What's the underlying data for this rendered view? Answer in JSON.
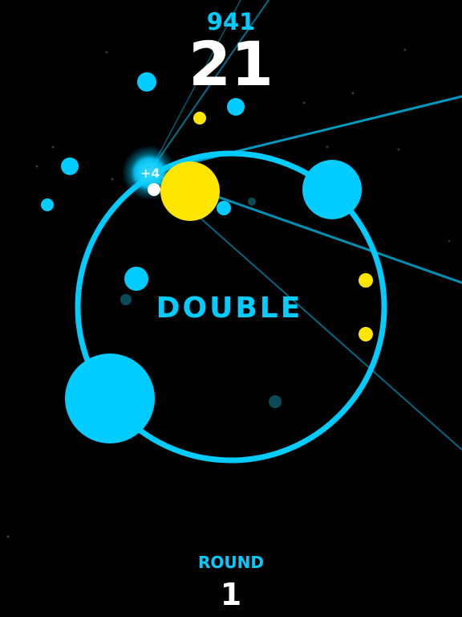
{
  "hud": {
    "best_score": "941",
    "score": "21",
    "round_label": "ROUND",
    "round_number": "1"
  },
  "bonus_text": "DOUBLE",
  "score_popup": "+4",
  "colors": {
    "background": "#000000",
    "cyan": "#00ccff",
    "yellow": "#ffe600",
    "ring": "#00ccff",
    "dark_cyan": "#0b4b57",
    "star": "#3a3a3a",
    "white": "#ffffff"
  },
  "icons": {
    "player": "glowing-cyan-orb",
    "orbs": "solid-circles"
  }
}
